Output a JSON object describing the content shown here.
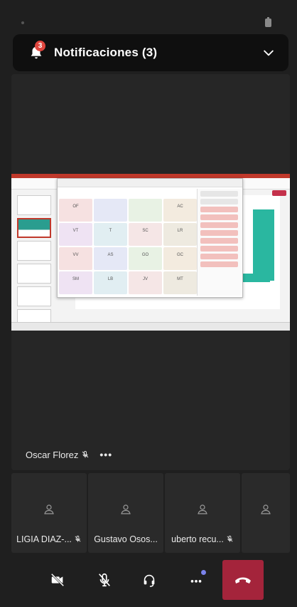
{
  "notifications": {
    "title": "Notificaciones (3)",
    "badge_count": "3"
  },
  "stage": {
    "speaker_name": "Oscar Florez",
    "more_label": "•••",
    "shared_grid_initials": [
      "OF",
      "",
      "",
      "AC",
      "VT",
      "T",
      "SC",
      "LR",
      "VV",
      "AS",
      "GO",
      "GC",
      "SM",
      "LB",
      "JV",
      "MT"
    ]
  },
  "participants": [
    {
      "name": "LIGIA DIAZ-...",
      "muted": true
    },
    {
      "name": "Gustavo Osos...",
      "muted": false
    },
    {
      "name": "uberto recu...",
      "muted": true
    },
    {
      "name": "",
      "muted": false
    }
  ],
  "controls": {
    "camera": "camera-off-icon",
    "mic": "mic-off-icon",
    "audio": "headset-icon",
    "more": "more-icon",
    "hangup": "hangup-icon"
  },
  "colors": {
    "hangup": "#a4243b",
    "badge": "#e0463e",
    "more_dot": "#7b83eb"
  }
}
